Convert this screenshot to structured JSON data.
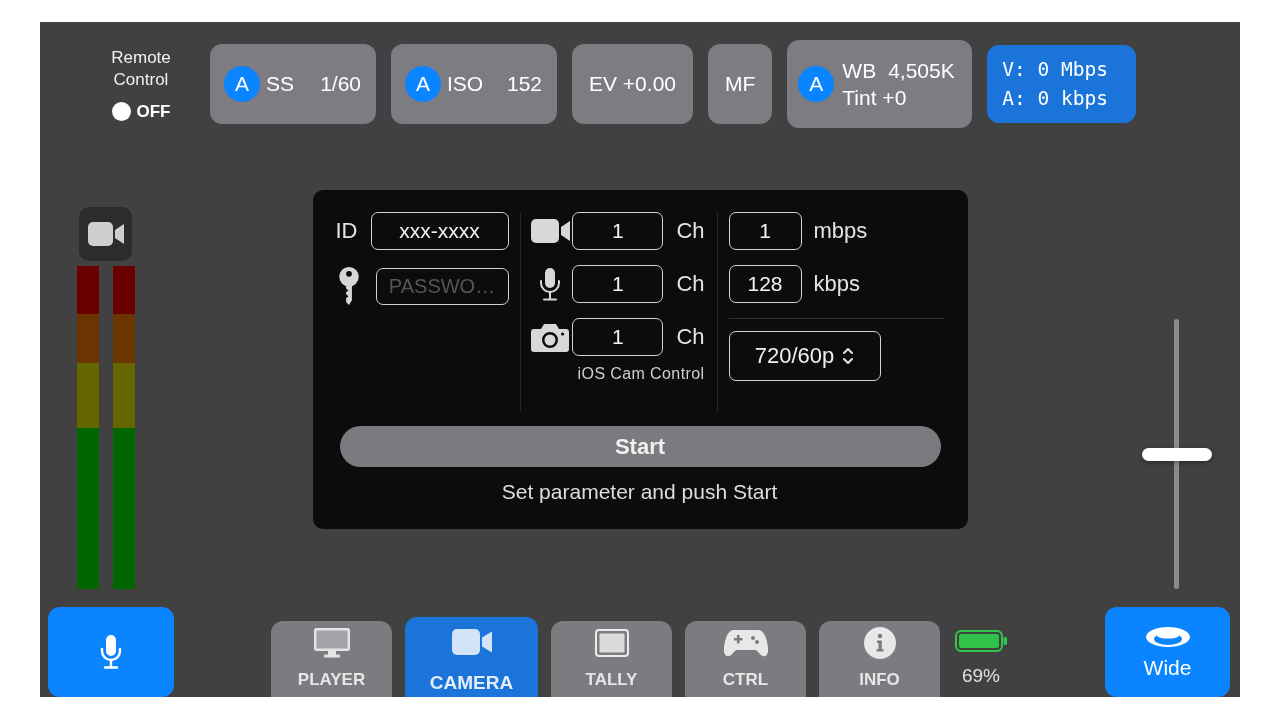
{
  "remote_control": {
    "label": "Remote Control",
    "on": false,
    "state_text": "OFF"
  },
  "camera_controls": [
    {
      "kind": "value",
      "badge": "A",
      "label": "SS",
      "value": "1/60"
    },
    {
      "kind": "value",
      "badge": "A",
      "label": "ISO",
      "value": "152"
    },
    {
      "kind": "plain",
      "label": "EV +0.00"
    },
    {
      "kind": "plain",
      "label": "MF"
    },
    {
      "kind": "white_balance",
      "badge": "A",
      "label": "WB",
      "value": "4,505K",
      "tint": "Tint +0"
    }
  ],
  "bitrate_status": {
    "video": "V: 0 Mbps",
    "audio": "A: 0 kbps"
  },
  "stream_settings": {
    "id": {
      "label": "ID",
      "value": "xxx-xxxx"
    },
    "password": {
      "placeholder": "PASSWO…"
    },
    "channels": [
      {
        "kind": "video",
        "value": "1",
        "unit": "Ch"
      },
      {
        "kind": "audio",
        "value": "1",
        "unit": "Ch"
      },
      {
        "kind": "photo",
        "value": "1",
        "unit": "Ch",
        "caption": "iOS Cam Control"
      }
    ],
    "bitrates": [
      {
        "value": "1",
        "unit": "mbps"
      },
      {
        "value": "128",
        "unit": "kbps"
      }
    ],
    "resolution": "720/60p",
    "start_button": "Start",
    "message": "Set parameter and push Start"
  },
  "zoom_slider": {
    "level": 0.5
  },
  "lens_button": {
    "label": "Wide"
  },
  "tabs": [
    {
      "label": "PLAYER",
      "selected": false
    },
    {
      "label": "CAMERA",
      "selected": true
    },
    {
      "label": "TALLY",
      "selected": false
    },
    {
      "label": "CTRL",
      "selected": false
    },
    {
      "label": "INFO",
      "selected": false
    }
  ],
  "battery": {
    "reading": "69%"
  }
}
